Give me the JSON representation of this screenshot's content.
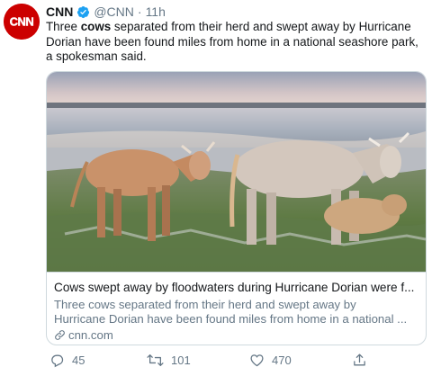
{
  "account": {
    "name": "CNN",
    "handle": "@CNN",
    "time": "11h",
    "avatar_text": "CNN"
  },
  "tweet": {
    "lines": [
      {
        "before": "Three ",
        "bold": "cows",
        "after": " separated from their herd and swept away by Hurricane"
      },
      {
        "before": "Dorian have been found miles from home in a national seashore park,",
        "bold": "",
        "after": ""
      },
      {
        "before": "a spokesman said.",
        "bold": "",
        "after": ""
      }
    ]
  },
  "card": {
    "title": "Cows swept away by floodwaters during Hurricane Dorian were f...",
    "desc_line1": "Three cows separated from their herd and swept away by",
    "desc_line2": "Hurricane Dorian have been found miles from home in a national ...",
    "domain": "cnn.com",
    "image_icon": "cows-on-beach-photo"
  },
  "actions": {
    "reply_count": "45",
    "retweet_count": "101",
    "like_count": "470"
  },
  "colors": {
    "brand": "#cc0000",
    "verified": "#1da1f2",
    "muted": "#657786"
  }
}
